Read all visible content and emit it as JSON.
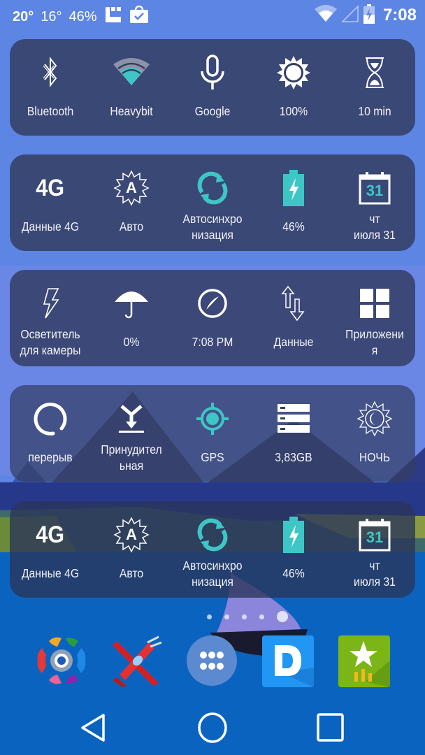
{
  "statusbar": {
    "temp_current": "20°",
    "temp_low": "16°",
    "humidity": "46%",
    "left_icons": [
      "launcher-notification-icon",
      "shopping-bag-check-icon"
    ],
    "right_icons": [
      "wifi-icon",
      "cell-signal-icon",
      "battery-charging-icon"
    ],
    "time": "7:08"
  },
  "panels": [
    {
      "tiles": [
        {
          "icon": "bluetooth-icon",
          "label": "Bluetooth"
        },
        {
          "icon": "wifi-icon",
          "label": "Heavybit"
        },
        {
          "icon": "microphone-icon",
          "label": "Google"
        },
        {
          "icon": "brightness-icon",
          "label": "100%"
        },
        {
          "icon": "hourglass-icon",
          "label": "10 min"
        }
      ]
    },
    {
      "tiles": [
        {
          "icon": "4g-icon",
          "icon_text": "4G",
          "label": "Данные 4G"
        },
        {
          "icon": "auto-brightness-icon",
          "icon_text": "A",
          "label": "Авто"
        },
        {
          "icon": "sync-icon",
          "label": "Автосинхро\nнизация"
        },
        {
          "icon": "battery-icon",
          "label": "46%"
        },
        {
          "icon": "calendar-icon",
          "icon_text": "31",
          "label": "чт\nиюля 31"
        }
      ]
    },
    {
      "tiles": [
        {
          "icon": "flashlight-icon",
          "label": "Осветитель\nдля камеры"
        },
        {
          "icon": "umbrella-icon",
          "label": "0%"
        },
        {
          "icon": "compass-icon",
          "label": "7:08 PM"
        },
        {
          "icon": "data-transfer-icon",
          "label": "Данные"
        },
        {
          "icon": "apps-grid-icon",
          "label": "Приложени\nя"
        }
      ]
    },
    {
      "tiles": [
        {
          "icon": "zen-circle-icon",
          "label": "перерыв"
        },
        {
          "icon": "force-merge-icon",
          "label": "Принудител\nьная"
        },
        {
          "icon": "gps-icon",
          "label": "GPS"
        },
        {
          "icon": "storage-icon",
          "label": "3,83GB"
        },
        {
          "icon": "night-mode-icon",
          "label": "НОЧЬ"
        }
      ]
    },
    {
      "tiles": [
        {
          "icon": "4g-icon",
          "icon_text": "4G",
          "label": "Данные 4G"
        },
        {
          "icon": "auto-brightness-icon",
          "icon_text": "A",
          "label": "Авто"
        },
        {
          "icon": "sync-icon",
          "label": "Автосинхро\nнизация"
        },
        {
          "icon": "battery-icon",
          "label": "46%"
        },
        {
          "icon": "calendar-icon",
          "icon_text": "31",
          "label": "чт\nиюля 31"
        }
      ]
    }
  ],
  "page_indicator": {
    "count": 5,
    "active": 4
  },
  "dock": {
    "apps": [
      {
        "name": "color-hexagon-app-icon"
      },
      {
        "name": "red-airplane-game-icon"
      },
      {
        "name": "app-drawer-icon"
      },
      {
        "name": "dictionary-d-app-icon",
        "letter": "D"
      },
      {
        "name": "star-rating-app-icon"
      }
    ]
  },
  "navbar": {
    "buttons": [
      "back",
      "home",
      "recents"
    ]
  },
  "colors": {
    "accent_teal": "#3ec6c6",
    "panel_bg": "#343e64",
    "sky": "#5d85e3",
    "dock_bg": "#0b63c0"
  }
}
